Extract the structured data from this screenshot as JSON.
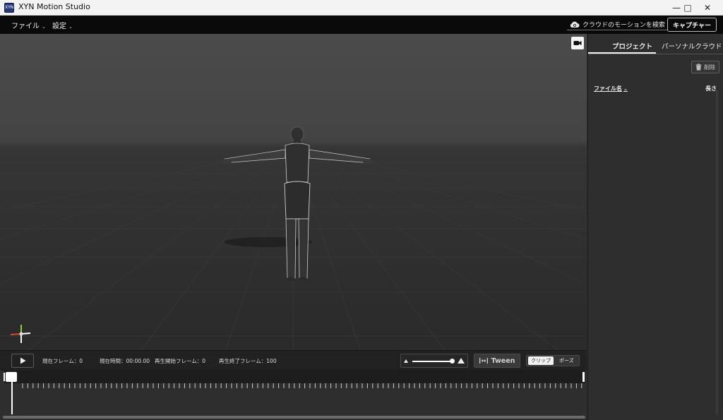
{
  "window": {
    "title": "XYN Motion Studio",
    "icon_label": "XYN",
    "controls": [
      "minimize-icon",
      "maximize-icon",
      "close-icon"
    ]
  },
  "menu": {
    "file": "ファイル",
    "settings": "設定",
    "cloud_search": "クラウドのモーションを検索",
    "capture": "キャプチャー"
  },
  "panel": {
    "tabs": [
      "プロジェクト",
      "パーソナルクラウド"
    ],
    "active_tab": "プロジェクト",
    "delete": "削除",
    "col_filename": "ファイル名",
    "col_length": "長さ"
  },
  "playback": {
    "current_frame": "現在フレーム：0",
    "current_time": "現在時間：00:00.00",
    "start_frame": "再生開始フレーム：0",
    "end_frame": "再生終了フレーム：100",
    "speed_fraction": 1.0,
    "tween": "Tween",
    "mode_clip": "クリップ",
    "mode_pose": "ポーズ",
    "active_mode": "クリップ"
  },
  "colors": {
    "axis_x": "#e0442a",
    "axis_y": "#8ad23c",
    "axis_z": "#ffffff"
  }
}
